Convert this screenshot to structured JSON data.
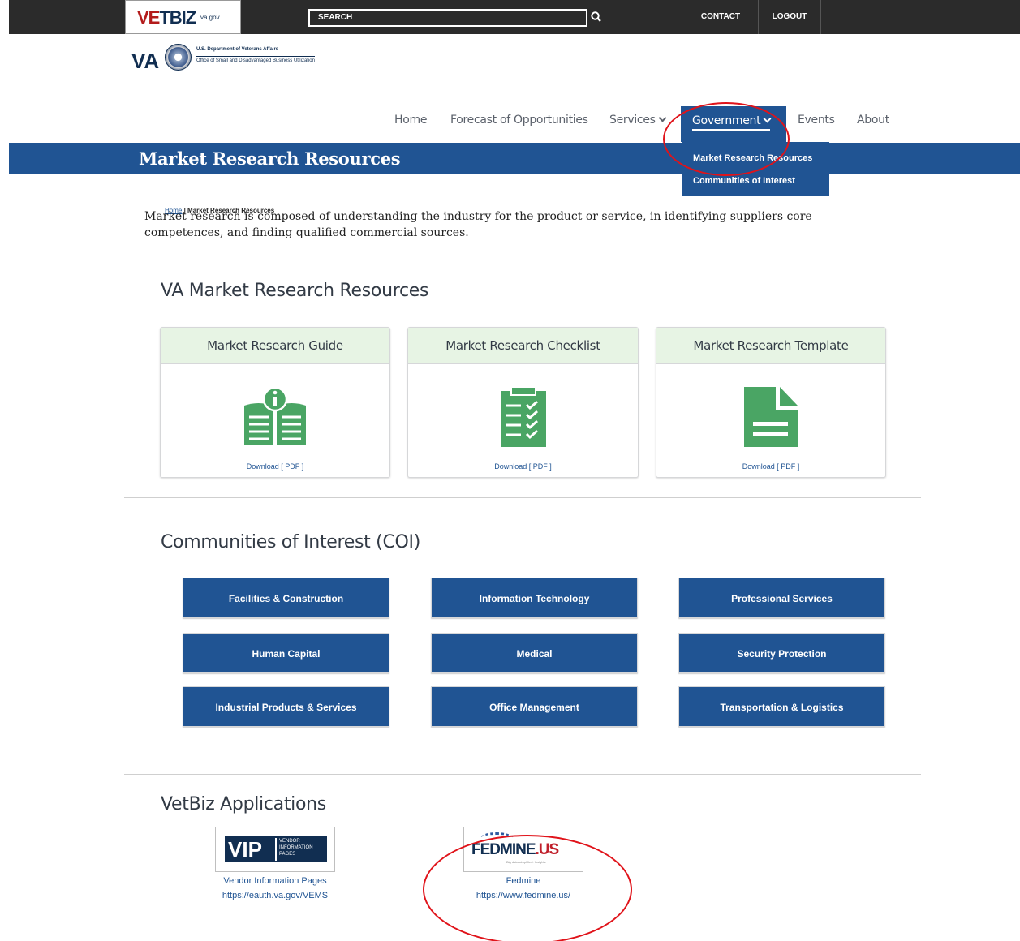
{
  "topbar": {
    "logo_main": "VETBIZ",
    "logo_accent": "VE",
    "logo_rest": "TBIZ",
    "logo_domain": "va.gov",
    "search_placeholder": "SEARCH",
    "contact_label": "CONTACT",
    "logout_label": "LOGOUT"
  },
  "va_header": {
    "letters": "VA",
    "department": "U.S. Department of Veterans Affairs",
    "office": "Office of Small and Disadvantaged Business Utilization"
  },
  "nav": {
    "home": "Home",
    "forecast": "Forecast of Opportunities",
    "services": "Services",
    "government": "Government",
    "events": "Events",
    "about": "About"
  },
  "dropdown": {
    "items": [
      "Market Research Resources",
      "Communities of Interest"
    ]
  },
  "page": {
    "title": "Market Research Resources",
    "breadcrumb_home": "Home",
    "breadcrumb_sep": " | ",
    "breadcrumb_current": "Market Research Resources",
    "intro": "Market research is composed of understanding the industry for the product or service, in identifying suppliers core competences, and finding qualified commercial sources."
  },
  "market_research": {
    "heading": "VA Market Research Resources",
    "cards": [
      {
        "title": "Market Research Guide",
        "link": "Download [ PDF ]",
        "icon": "book-info-icon"
      },
      {
        "title": "Market Research Checklist",
        "link": "Download [ PDF ]",
        "icon": "checklist-icon"
      },
      {
        "title": "Market Research Template",
        "link": "Download [ PDF ]",
        "icon": "document-icon"
      }
    ],
    "icon_color": "#4aa564",
    "card_header_bg": "#e7f4e4"
  },
  "coi": {
    "heading": "Communities of Interest (COI)",
    "buttons": [
      "Facilities & Construction",
      "Information Technology",
      "Professional Services",
      "Human Capital",
      "Medical",
      "Security Protection",
      "Industrial Products & Services",
      "Office Management",
      "Transportation & Logistics"
    ]
  },
  "apps": {
    "heading": "VetBiz Applications",
    "vip": {
      "logo_text": "VIP",
      "logo_sub": "VENDOR INFORMATION PAGES",
      "name": "Vendor Information Pages",
      "url": "https://eauth.va.gov/VEMS"
    },
    "fedmine": {
      "logo_main": "FEDMINE",
      "logo_suffix": ".US",
      "logo_tag": "Big data simplified. Insights",
      "name": "Fedmine",
      "url": "https://www.fedmine.us/"
    }
  },
  "colors": {
    "primary_blue": "#205493",
    "topbar": "#2b2b2b",
    "annotation_red": "#e0131a"
  }
}
